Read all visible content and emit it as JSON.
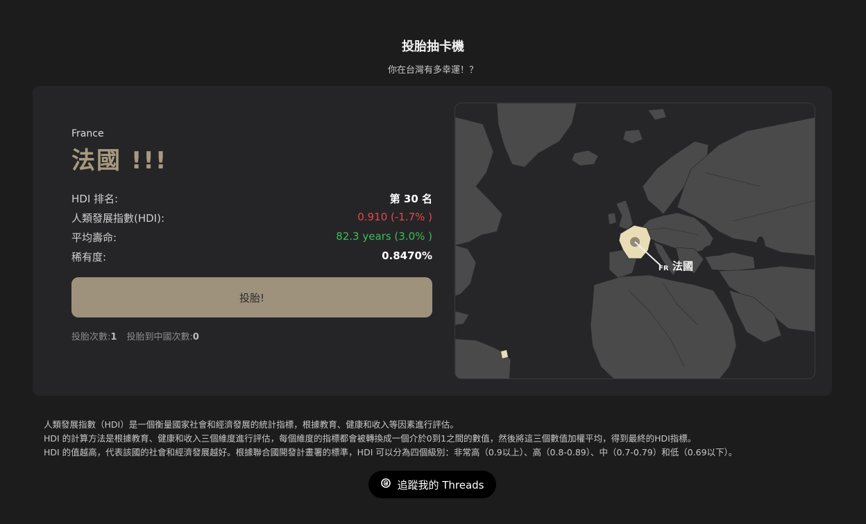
{
  "header": {
    "title": "投胎抽卡機",
    "subtitle": "你在台灣有多幸運！？"
  },
  "result": {
    "country_en": "France",
    "country_zh": "法國 !!!",
    "stats": [
      {
        "label": "HDI 排名:",
        "value": "第 30 名",
        "color": "#ffffff"
      },
      {
        "label": "人類發展指數(HDI):",
        "value": "0.910 (-1.7% )",
        "color": "#e5474b"
      },
      {
        "label": "平均壽命:",
        "value": "82.3 years (3.0% )",
        "color": "#3cbf5a"
      },
      {
        "label": "稀有度:",
        "value": "0.8470%",
        "color": "#ffffff"
      }
    ],
    "roll_button": "投胎!",
    "counts": {
      "rolls_label": "投胎次數:",
      "rolls_value": "1",
      "china_label": "投胎到中國次數:",
      "china_value": "0"
    }
  },
  "map": {
    "marker_code": "FR",
    "marker_name": "法國",
    "highlight_color": "#e8ddb5",
    "land_color": "#4a4a4b",
    "sea_color": "#262628"
  },
  "description": {
    "lines": [
      "人類發展指數（HDI）是一個衡量國家社會和經濟發展的統計指標，根據教育、健康和收入等因素進行評估。",
      "HDI 的計算方法是根據教育、健康和收入三個維度進行評估，每個維度的指標都會被轉換成一個介於0到1之間的數值，然後將這三個數值加權平均，得到最終的HDI指標。",
      "HDI 的值越高，代表該國的社會和經濟發展越好。根據聯合國開發計畫署的標準，HDI 可以分為四個級別：非常高（0.9以上）、高（0.8-0.89）、中（0.7-0.79）和低（0.69以下）。"
    ]
  },
  "footer": {
    "threads_button": "追蹤我的 Threads",
    "threads_icon": "threads-icon"
  }
}
